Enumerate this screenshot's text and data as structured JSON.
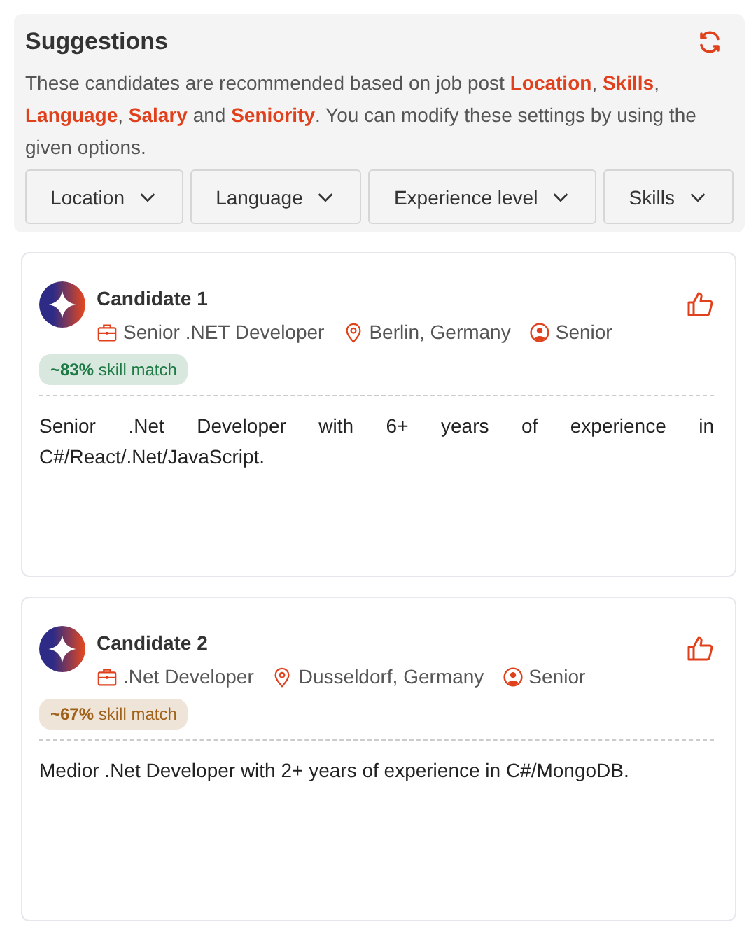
{
  "suggestions": {
    "title": "Suggestions",
    "description": "These candidates are recommended based on job post **Location**, **Skills**, **Language**, **Salary** and **Seniority**. You can modify these settings by using the given options.",
    "filters": [
      {
        "label": "Location"
      },
      {
        "label": "Language"
      },
      {
        "label": "Experience level"
      },
      {
        "label": "Skills"
      }
    ]
  },
  "candidates": [
    {
      "name": "Candidate 1",
      "role": "Senior .NET Developer",
      "location": "Berlin, Germany",
      "seniority": "Senior",
      "match": "**~83%** skill match",
      "color": "#1e7a45",
      "summary": "Senior .Net Developer with 6+ years of experience in C#/React/.Net/JavaScript."
    },
    {
      "name": "Candidate 2",
      "role": ".Net Developer",
      "location": "Dusseldorf, Germany",
      "seniority": "Senior",
      "match": "**~67%** skill match",
      "color": "#a0621a",
      "summary": "Medior .Net Developer with 2+ years of experience in C#/MongoDB."
    }
  ]
}
